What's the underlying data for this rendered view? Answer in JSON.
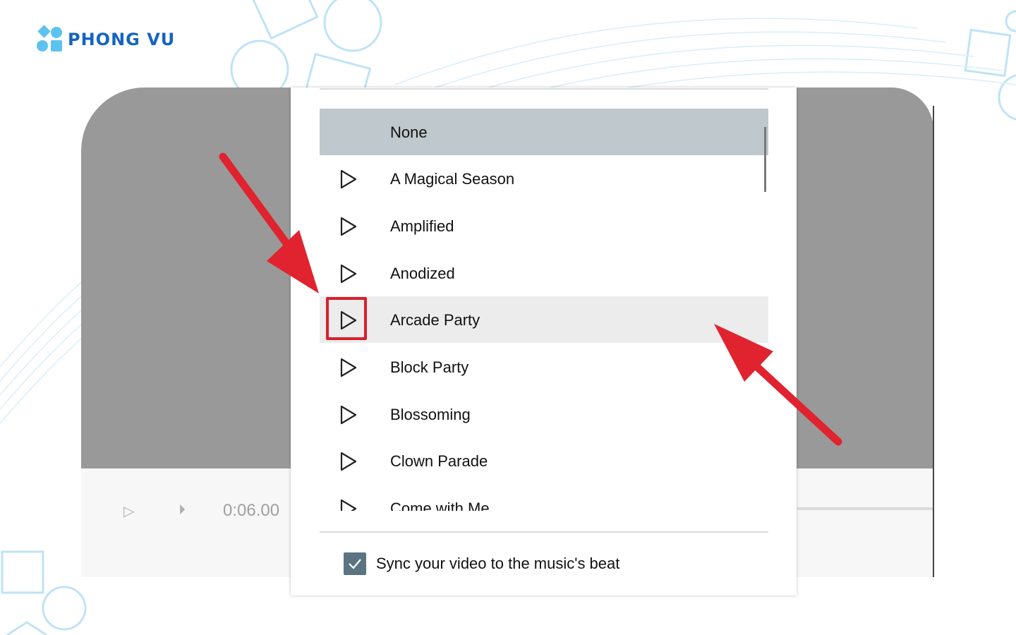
{
  "brand": {
    "name": "PHONG VU"
  },
  "player": {
    "time": "0:06.00",
    "play_icon": "play-icon",
    "step_icon": "step-forward-icon"
  },
  "music_list": {
    "tracks": [
      {
        "label": "None",
        "selected": true
      },
      {
        "label": "A Magical Season"
      },
      {
        "label": "Amplified"
      },
      {
        "label": "Anodized"
      },
      {
        "label": "Arcade Party",
        "highlighted": true
      },
      {
        "label": "Block Party"
      },
      {
        "label": "Blossoming"
      },
      {
        "label": "Clown Parade"
      },
      {
        "label": "Come with Me"
      }
    ],
    "sync": {
      "label": "Sync your video to the music's beat",
      "checked": true
    }
  },
  "colors": {
    "accent_red": "#d8202c",
    "selected_row": "#bfc8cc",
    "checkbox": "#5b7482",
    "brand_blue": "#1565c0",
    "brand_light": "#5cc3f0"
  }
}
